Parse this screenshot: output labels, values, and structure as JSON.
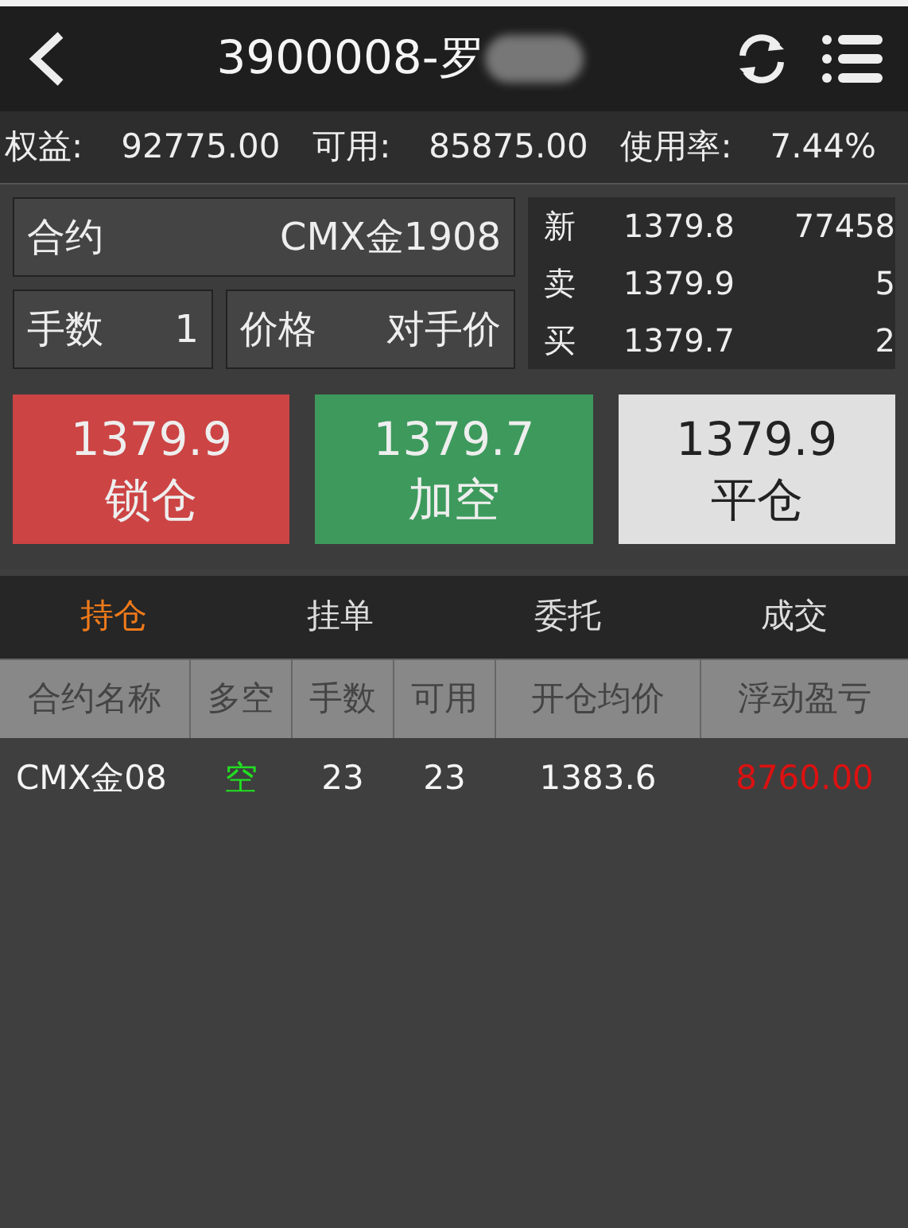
{
  "header": {
    "title": "3900008-罗"
  },
  "account": [
    {
      "label": "权益:",
      "value": "92775.00"
    },
    {
      "label": "可用:",
      "value": "85875.00"
    },
    {
      "label": "使用率:",
      "value": "7.44%"
    }
  ],
  "order_form": {
    "contract": {
      "label": "合约",
      "value": "CMX金1908"
    },
    "lots": {
      "label": "手数",
      "value": "1"
    },
    "price": {
      "label": "价格",
      "value": "对手价"
    }
  },
  "quote": [
    {
      "label": "新",
      "price": "1379.8",
      "volume": "77458"
    },
    {
      "label": "卖",
      "price": "1379.9",
      "volume": "5"
    },
    {
      "label": "买",
      "price": "1379.7",
      "volume": "2"
    }
  ],
  "actions": [
    {
      "kind": "lock",
      "price": "1379.9",
      "label": "锁仓"
    },
    {
      "kind": "short",
      "price": "1379.7",
      "label": "加空"
    },
    {
      "kind": "close",
      "price": "1379.9",
      "label": "平仓"
    }
  ],
  "tabs": [
    {
      "label": "持仓",
      "selected": true
    },
    {
      "label": "挂单",
      "selected": false
    },
    {
      "label": "委托",
      "selected": false
    },
    {
      "label": "成交",
      "selected": false
    }
  ],
  "table": {
    "columns": [
      "合约名称",
      "多空",
      "手数",
      "可用",
      "开仓均价",
      "浮动盈亏"
    ],
    "rows": [
      {
        "contract": "CMX金08",
        "direction": {
          "text": "空",
          "kind": "short"
        },
        "lots": "23",
        "available": "23",
        "avg_price": "1383.6",
        "pnl": {
          "text": "8760.00",
          "kind": "profit"
        }
      }
    ]
  }
}
